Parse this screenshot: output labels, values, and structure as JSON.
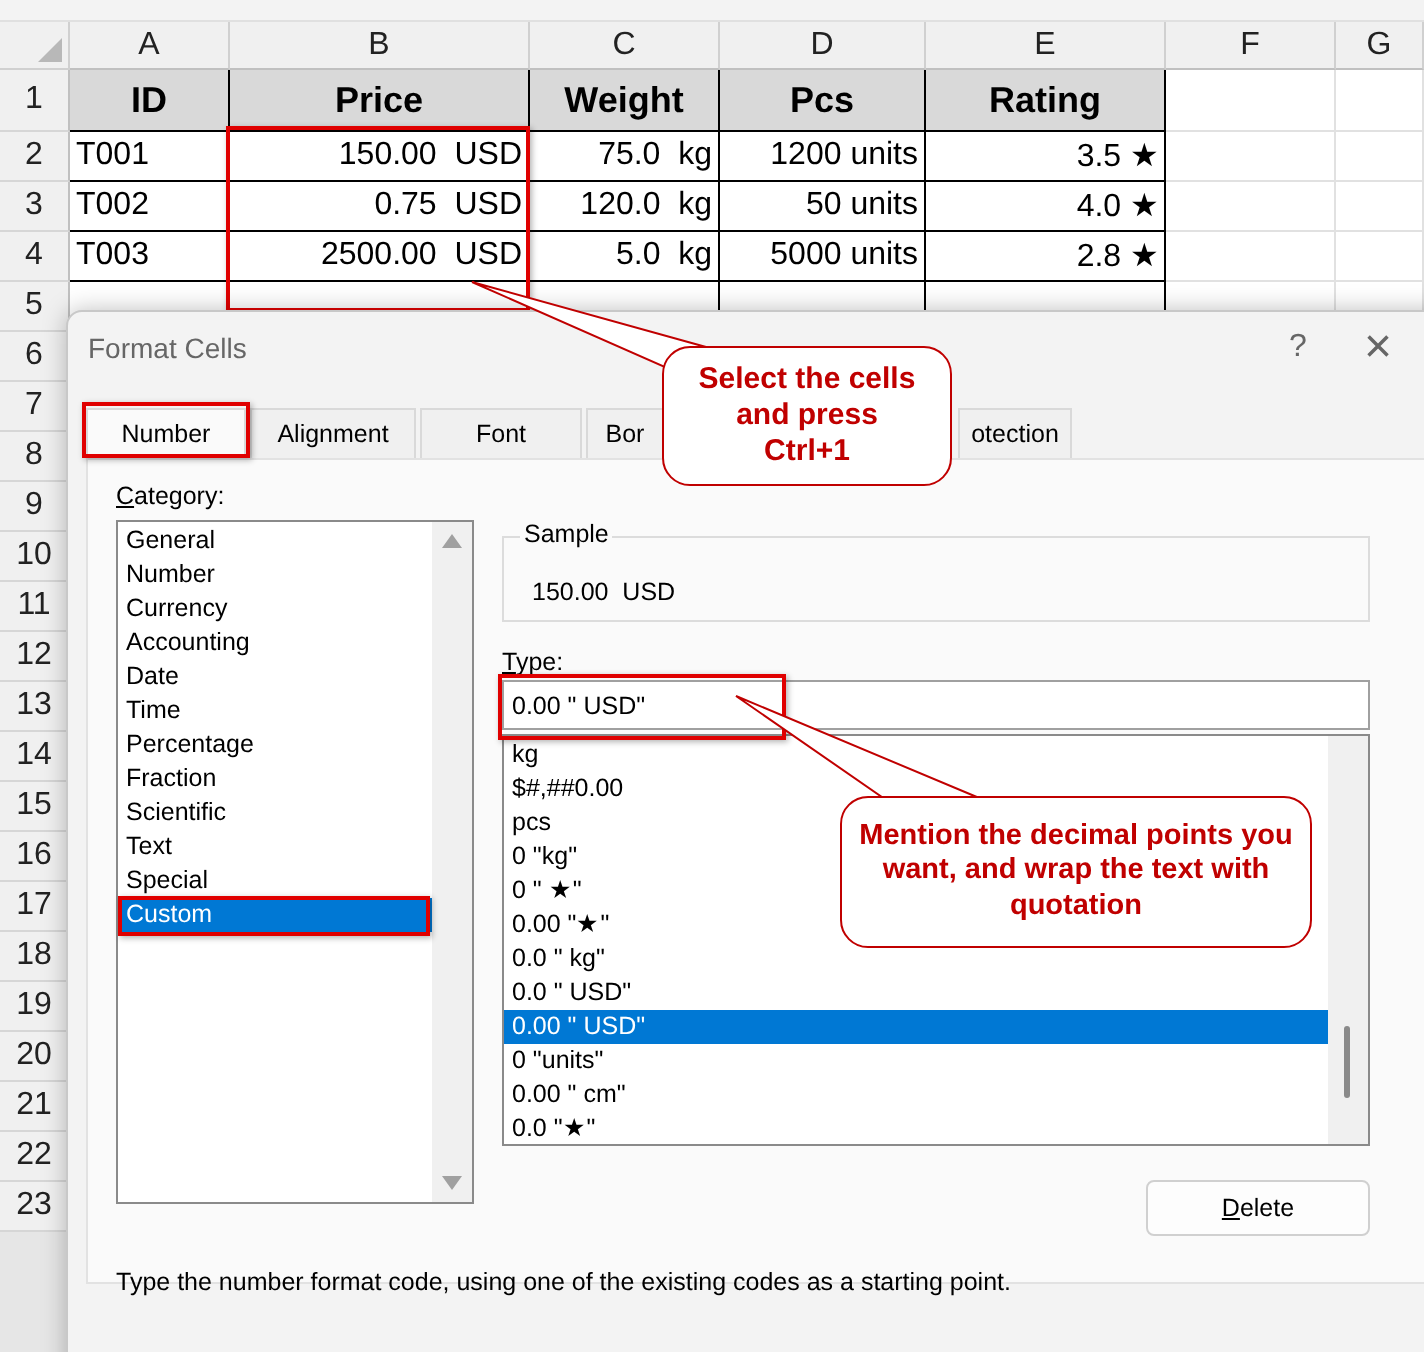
{
  "sheet": {
    "column_headers": [
      "A",
      "B",
      "C",
      "D",
      "E",
      "F",
      "G"
    ],
    "row_numbers": [
      "1",
      "2",
      "3",
      "4",
      "5",
      "6",
      "7",
      "8",
      "9",
      "10",
      "11",
      "12",
      "13",
      "14",
      "15",
      "16",
      "17",
      "18",
      "19",
      "20",
      "21",
      "22",
      "23"
    ],
    "header_row": [
      "ID",
      "Price",
      "Weight",
      "Pcs",
      "Rating"
    ],
    "rows": [
      [
        "T001",
        "150.00  USD",
        "75.0  kg",
        "1200 units",
        "3.5 ★"
      ],
      [
        "T002",
        "0.75  USD",
        "120.0  kg",
        "50 units",
        "4.0 ★"
      ],
      [
        "T003",
        "2500.00  USD",
        "5.0  kg",
        "5000 units",
        "2.8 ★"
      ]
    ]
  },
  "dialog": {
    "title": "Format Cells",
    "help": "?",
    "close": "×",
    "tabs": [
      {
        "label": "Number",
        "selected": true
      },
      {
        "label": "Alignment",
        "selected": false
      },
      {
        "label": "Font",
        "selected": false
      },
      {
        "label": "Bor",
        "selected": false
      },
      {
        "label": "otection",
        "selected": false
      }
    ],
    "category_label": "Category:",
    "categories": [
      {
        "label": "General",
        "selected": false
      },
      {
        "label": "Number",
        "selected": false
      },
      {
        "label": "Currency",
        "selected": false
      },
      {
        "label": "Accounting",
        "selected": false
      },
      {
        "label": "Date",
        "selected": false
      },
      {
        "label": "Time",
        "selected": false
      },
      {
        "label": "Percentage",
        "selected": false
      },
      {
        "label": "Fraction",
        "selected": false
      },
      {
        "label": "Scientific",
        "selected": false
      },
      {
        "label": "Text",
        "selected": false
      },
      {
        "label": "Special",
        "selected": false
      },
      {
        "label": "Custom",
        "selected": true
      }
    ],
    "sample_label": "Sample",
    "sample_value": "150.00  USD",
    "type_label": "Type:",
    "type_value": "0.00 \" USD\"",
    "formats": [
      {
        "label": "kg",
        "selected": false
      },
      {
        "label": "$#,##0.00",
        "selected": false
      },
      {
        "label": "pcs",
        "selected": false
      },
      {
        "label": "0 \"kg\"",
        "selected": false
      },
      {
        "label": "0 \" ★\"",
        "selected": false
      },
      {
        "label": "0.00 \"★\"",
        "selected": false
      },
      {
        "label": "0.0 \" kg\"",
        "selected": false
      },
      {
        "label": "0.0 \" USD\"",
        "selected": false
      },
      {
        "label": "0.00 \" USD\"",
        "selected": true
      },
      {
        "label": "0 \"units\"",
        "selected": false
      },
      {
        "label": "0.00 \" cm\"",
        "selected": false
      },
      {
        "label": "0.0 \"★\"",
        "selected": false
      }
    ],
    "delete_button": "Delete",
    "description": "Type the number format code, using one of the existing codes as a starting point."
  },
  "callouts": [
    {
      "text": "Select the cells and press Ctrl+1"
    },
    {
      "text": "Mention the decimal points you want, and wrap the text with quotation"
    }
  ]
}
